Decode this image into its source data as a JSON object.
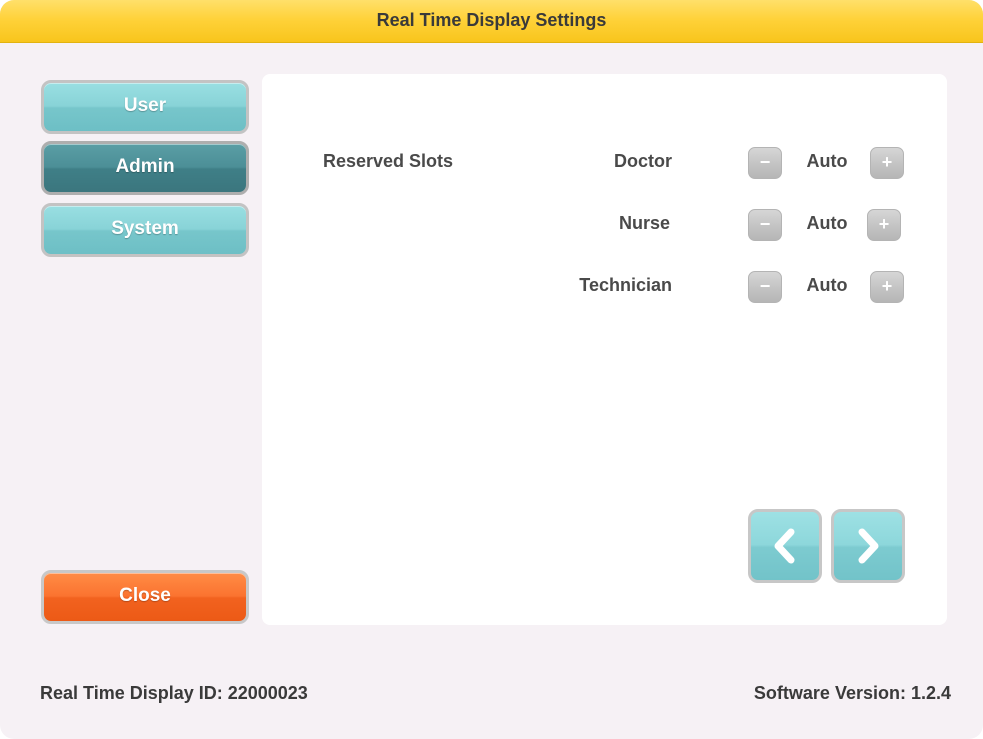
{
  "window": {
    "title": "Real Time Display Settings"
  },
  "sidebar": {
    "items": [
      {
        "label": "User",
        "active": false
      },
      {
        "label": "Admin",
        "active": true
      },
      {
        "label": "System",
        "active": false
      }
    ],
    "close_label": "Close"
  },
  "panel": {
    "section_label": "Reserved Slots",
    "slots": [
      {
        "name": "Doctor",
        "value": "Auto",
        "decrement_icon": "minus-icon",
        "increment_icon": "plus-icon"
      },
      {
        "name": "Nurse",
        "value": "Auto",
        "decrement_icon": "minus-icon",
        "increment_icon": "plus-icon"
      },
      {
        "name": "Technician",
        "value": "Auto",
        "decrement_icon": "minus-icon",
        "increment_icon": "plus-icon"
      }
    ],
    "nav_icons": {
      "previous": "chevron-left-icon",
      "next": "chevron-right-icon"
    }
  },
  "footer": {
    "display_id": "Real Time Display ID: 22000023",
    "software_version": "Software Version: 1.2.4"
  },
  "colors": {
    "title_bar": "#ffd23a",
    "nav_button": "#88d3d7",
    "nav_button_active": "#4c8f97",
    "close_button": "#fb7330",
    "stepper_button": "#c5c5c5",
    "background": "#f6f1f5",
    "panel": "#ffffff"
  }
}
